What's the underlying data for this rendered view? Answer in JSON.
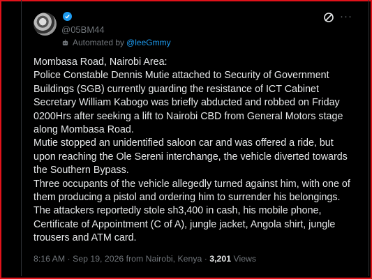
{
  "post": {
    "handle": "@05BM44",
    "automated_prefix": "Automated by",
    "automated_by": "@leeGmmy",
    "lines": [
      "Mombasa Road, Nairobi Area:",
      "Police Constable Dennis Mutie attached to Security of Government",
      "Buildings (SGB) currently guarding the resistance of ICT Cabinet",
      "Secretary William Kabogo was briefly abducted and robbed on Friday",
      "0200Hrs after seeking a lift to Nairobi CBD from General Motors stage",
      "along Mombasa Road.",
      "Mutie stopped an unidentified saloon car and was offered a ride, but",
      "upon reaching the Ole Sereni interchange, the vehicle diverted towards",
      "the Southern Bypass.",
      "Three occupants of the vehicle allegedly turned against him, with one of",
      "them producing a pistol and ordering him to surrender his belongings.",
      "The attackers reportedly stole sh3,400 in cash, his mobile phone,",
      "Certificate of Appointment (C of A), jungle jacket, Angola shirt, jungle",
      "trousers and ATM card."
    ],
    "time": "8:16 AM",
    "date": "Sep 19, 2026",
    "source": "from Nairobi, Kenya",
    "views_count": "3,201",
    "views_label": "Views",
    "separator": "·"
  },
  "icons": {
    "verified": "verified-badge-icon",
    "automated": "bot-icon",
    "grok": "grok-icon",
    "more": "more-icon"
  },
  "colors": {
    "background": "#000000",
    "text": "#e7e9ea",
    "muted": "#71767b",
    "accent": "#1d9bf0",
    "frame": "#e0121a"
  }
}
